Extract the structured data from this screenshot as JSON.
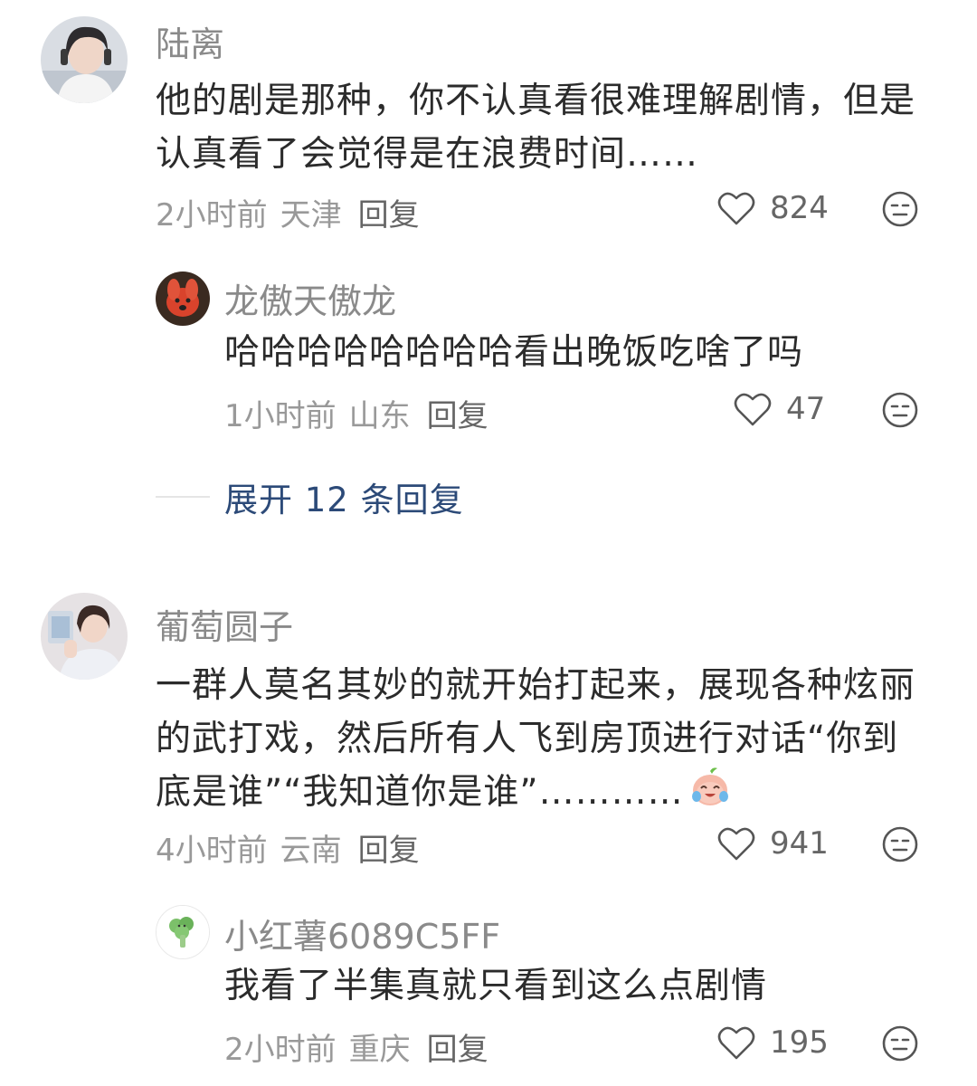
{
  "comments": [
    {
      "username": "陆离",
      "content": "他的剧是那种，你不认真看很难理解剧情，但是认真看了会觉得是在浪费时间……",
      "time": "2小时前",
      "location": "天津",
      "reply_label": "回复",
      "likes": "824"
    },
    {
      "username": "龙傲天傲龙",
      "content": "哈哈哈哈哈哈哈哈看出晚饭吃啥了吗",
      "time": "1小时前",
      "location": "山东",
      "reply_label": "回复",
      "likes": "47"
    },
    {
      "expand_label": "展开 12 条回复"
    },
    {
      "username": "葡萄圆子",
      "content": "一群人莫名其妙的就开始打起来，展现各种炫丽的武打戏，然后所有人飞到房顶进行对话“你到底是谁”“我知道你是谁”…………",
      "time": "4小时前",
      "location": "云南",
      "reply_label": "回复",
      "likes": "941"
    },
    {
      "username": "小红薯6089C5FF",
      "content": "我看了半集真就只看到这么点剧情",
      "time": "2小时前",
      "location": "重庆",
      "reply_label": "回复",
      "likes": "195"
    }
  ],
  "icons": {
    "like": "heart-outline-icon",
    "dislike": "meh-face-icon",
    "inline_emoji": "crying-laughing-peach-emoji"
  },
  "colors": {
    "expand_link": "#2c4a78",
    "username": "#8a8a8a",
    "meta": "#999999"
  }
}
